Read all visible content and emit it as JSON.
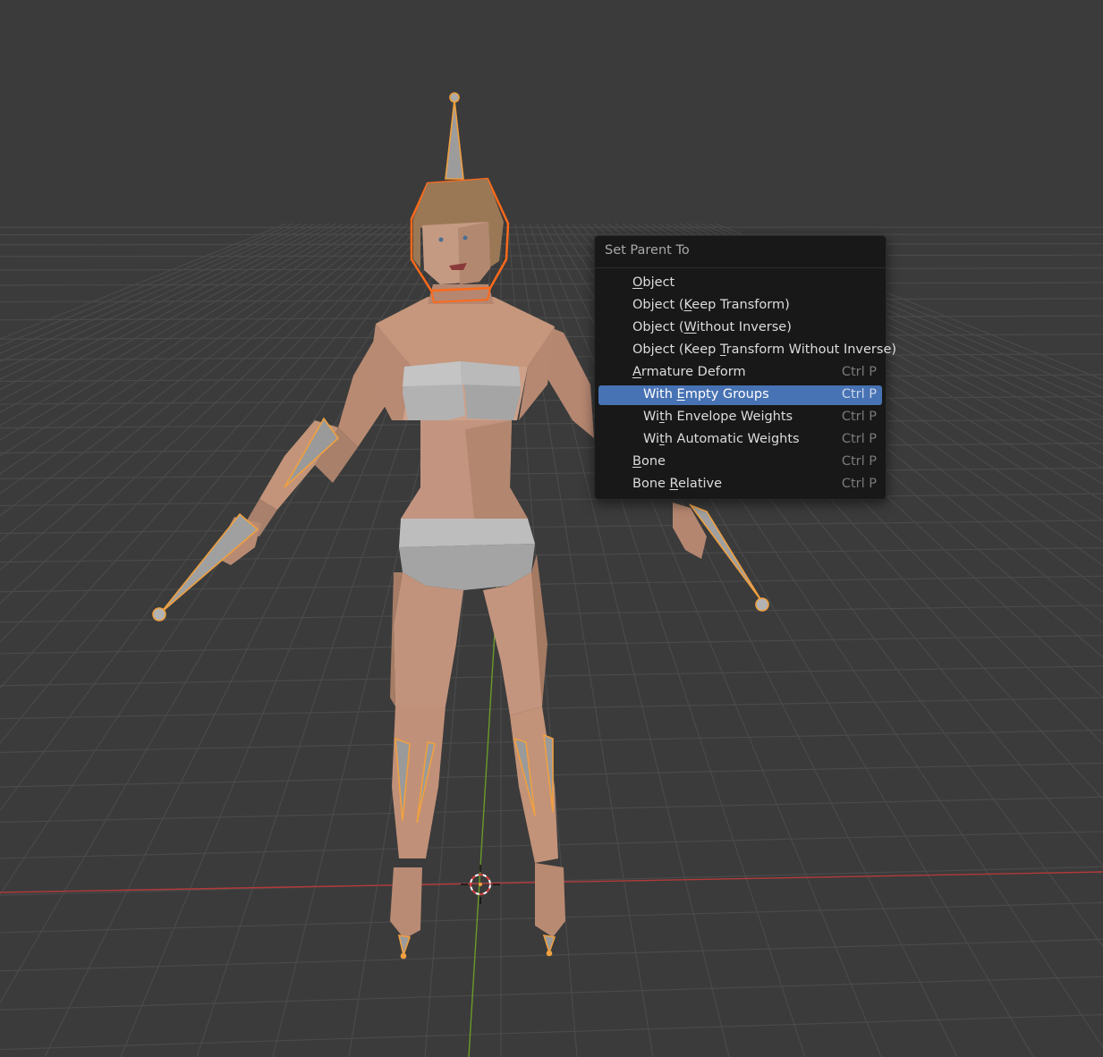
{
  "menu": {
    "title": "Set Parent To",
    "items": [
      {
        "label": "Object",
        "shortcut": "",
        "indent": false,
        "highlighted": false,
        "mnemonic_index": 0
      },
      {
        "label": "Object (Keep Transform)",
        "shortcut": "",
        "indent": false,
        "highlighted": false,
        "mnemonic_index": 8
      },
      {
        "label": "Object (Without Inverse)",
        "shortcut": "",
        "indent": false,
        "highlighted": false,
        "mnemonic_index": 8
      },
      {
        "label": "Object (Keep Transform Without Inverse)",
        "shortcut": "",
        "indent": false,
        "highlighted": false,
        "mnemonic_index": 13
      },
      {
        "label": "Armature Deform",
        "shortcut": "Ctrl P",
        "indent": false,
        "highlighted": false,
        "mnemonic_index": 0
      },
      {
        "label": "With Empty Groups",
        "shortcut": "Ctrl P",
        "indent": true,
        "highlighted": true,
        "mnemonic_index": 5
      },
      {
        "label": "With Envelope Weights",
        "shortcut": "Ctrl P",
        "indent": true,
        "highlighted": false,
        "mnemonic_index": 2
      },
      {
        "label": "With Automatic Weights",
        "shortcut": "Ctrl P",
        "indent": true,
        "highlighted": false,
        "mnemonic_index": 2
      },
      {
        "label": "Bone",
        "shortcut": "Ctrl P",
        "indent": false,
        "highlighted": false,
        "mnemonic_index": 0
      },
      {
        "label": "Bone Relative",
        "shortcut": "Ctrl P",
        "indent": false,
        "highlighted": false,
        "mnemonic_index": 5
      }
    ]
  },
  "colors": {
    "background": "#3b3b3b",
    "grid_line": "#4a4a4a",
    "x_axis": "#b23a3a",
    "y_axis": "#6a9a2a",
    "menu_bg": "#181818",
    "menu_highlight": "#4772b3",
    "skin": "#c8977e",
    "clothing": "#a7a7a7",
    "hair": "#9a7856",
    "selection_outline": "#ff6a1a",
    "bone_outline": "#f0a040",
    "bone_fill": "#8f8f8f"
  },
  "scene": {
    "objects": [
      "character-mesh",
      "armature",
      "3d-cursor"
    ]
  }
}
